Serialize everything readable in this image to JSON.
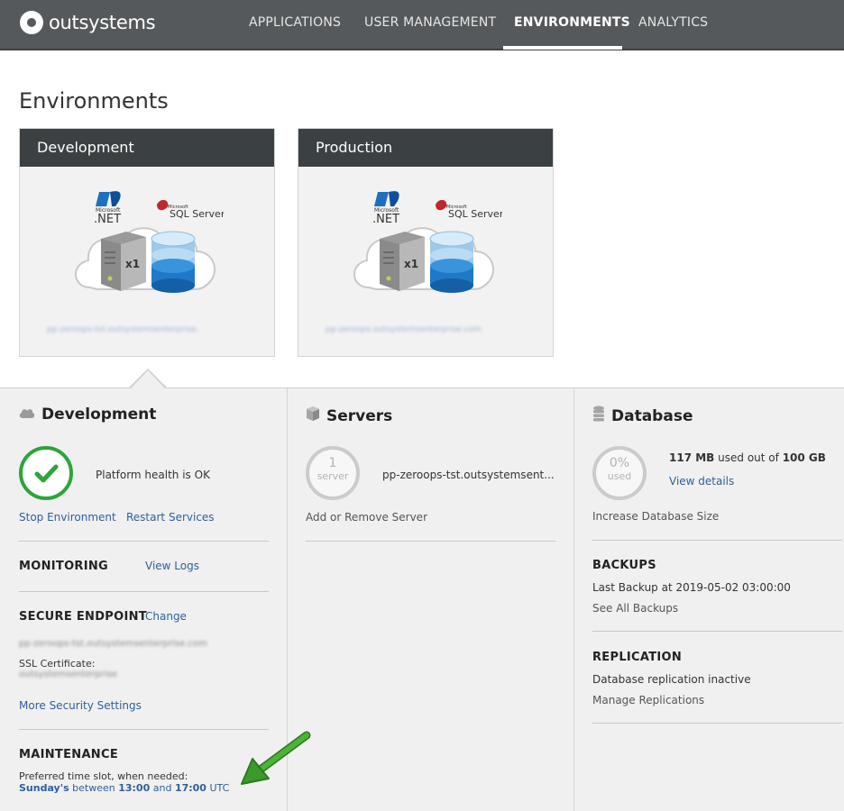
{
  "brand": {
    "name": "outsystems"
  },
  "nav": {
    "items": [
      {
        "label": "APPLICATIONS"
      },
      {
        "label": "USER MANAGEMENT"
      },
      {
        "label": "ENVIRONMENTS"
      },
      {
        "label": "ANALYTICS"
      }
    ],
    "active": "ENVIRONMENTS"
  },
  "page": {
    "title": "Environments"
  },
  "environments": [
    {
      "name": "Development",
      "net_label": ".NET",
      "ms_label": "Microsoft",
      "sql_label": "SQL Server",
      "server_count": "x1",
      "url": "pp-zeroops-tst.outsystemsenterprise."
    },
    {
      "name": "Production",
      "net_label": ".NET",
      "ms_label": "Microsoft",
      "sql_label": "SQL Server",
      "server_count": "x1",
      "url": "pp-zeroops.outsystemsenterprise.com"
    }
  ],
  "development": {
    "title": "Development",
    "health_text": "Platform health is OK",
    "stop_label": "Stop Environment",
    "restart_label": "Restart Services",
    "monitoring_label": "MONITORING",
    "view_logs_label": "View Logs",
    "secure_endpoint_label": "SECURE ENDPOINT",
    "change_label": "Change",
    "endpoint_url": "pp-zeroops-tst.outsystemsenterprise.com",
    "ssl_label": "SSL Certificate:",
    "ssl_value": "outsystemsenterprise",
    "more_security_label": "More Security Settings",
    "maintenance_label": "MAINTENANCE",
    "preferred_label": "Preferred time slot, when needed:",
    "slot_day": "Sunday's",
    "slot_between": "between",
    "slot_start": "13:00",
    "slot_and": "and",
    "slot_end": "17:00",
    "slot_tz": "UTC"
  },
  "servers": {
    "title": "Servers",
    "count": "1",
    "count_unit": "server",
    "server_name": "pp-zeroops-tst.outsystemsent...",
    "add_remove_label": "Add or Remove Server"
  },
  "database": {
    "title": "Database",
    "percent": "0%",
    "percent_unit": "used",
    "used": "117 MB",
    "used_mid": "used out of",
    "total": "100 GB",
    "view_details_label": "View details",
    "increase_label": "Increase Database Size",
    "backups_label": "BACKUPS",
    "last_backup": "Last Backup at 2019-05-02 03:00:00",
    "see_backups_label": "See All Backups",
    "replication_label": "REPLICATION",
    "replication_status": "Database replication inactive",
    "manage_replications_label": "Manage Replications"
  },
  "colors": {
    "topbar": "#55595c",
    "card_header": "#3b4043",
    "health_ok": "#2ea43b",
    "link": "#2f5f9b",
    "arrow": "#3a9a2a"
  }
}
